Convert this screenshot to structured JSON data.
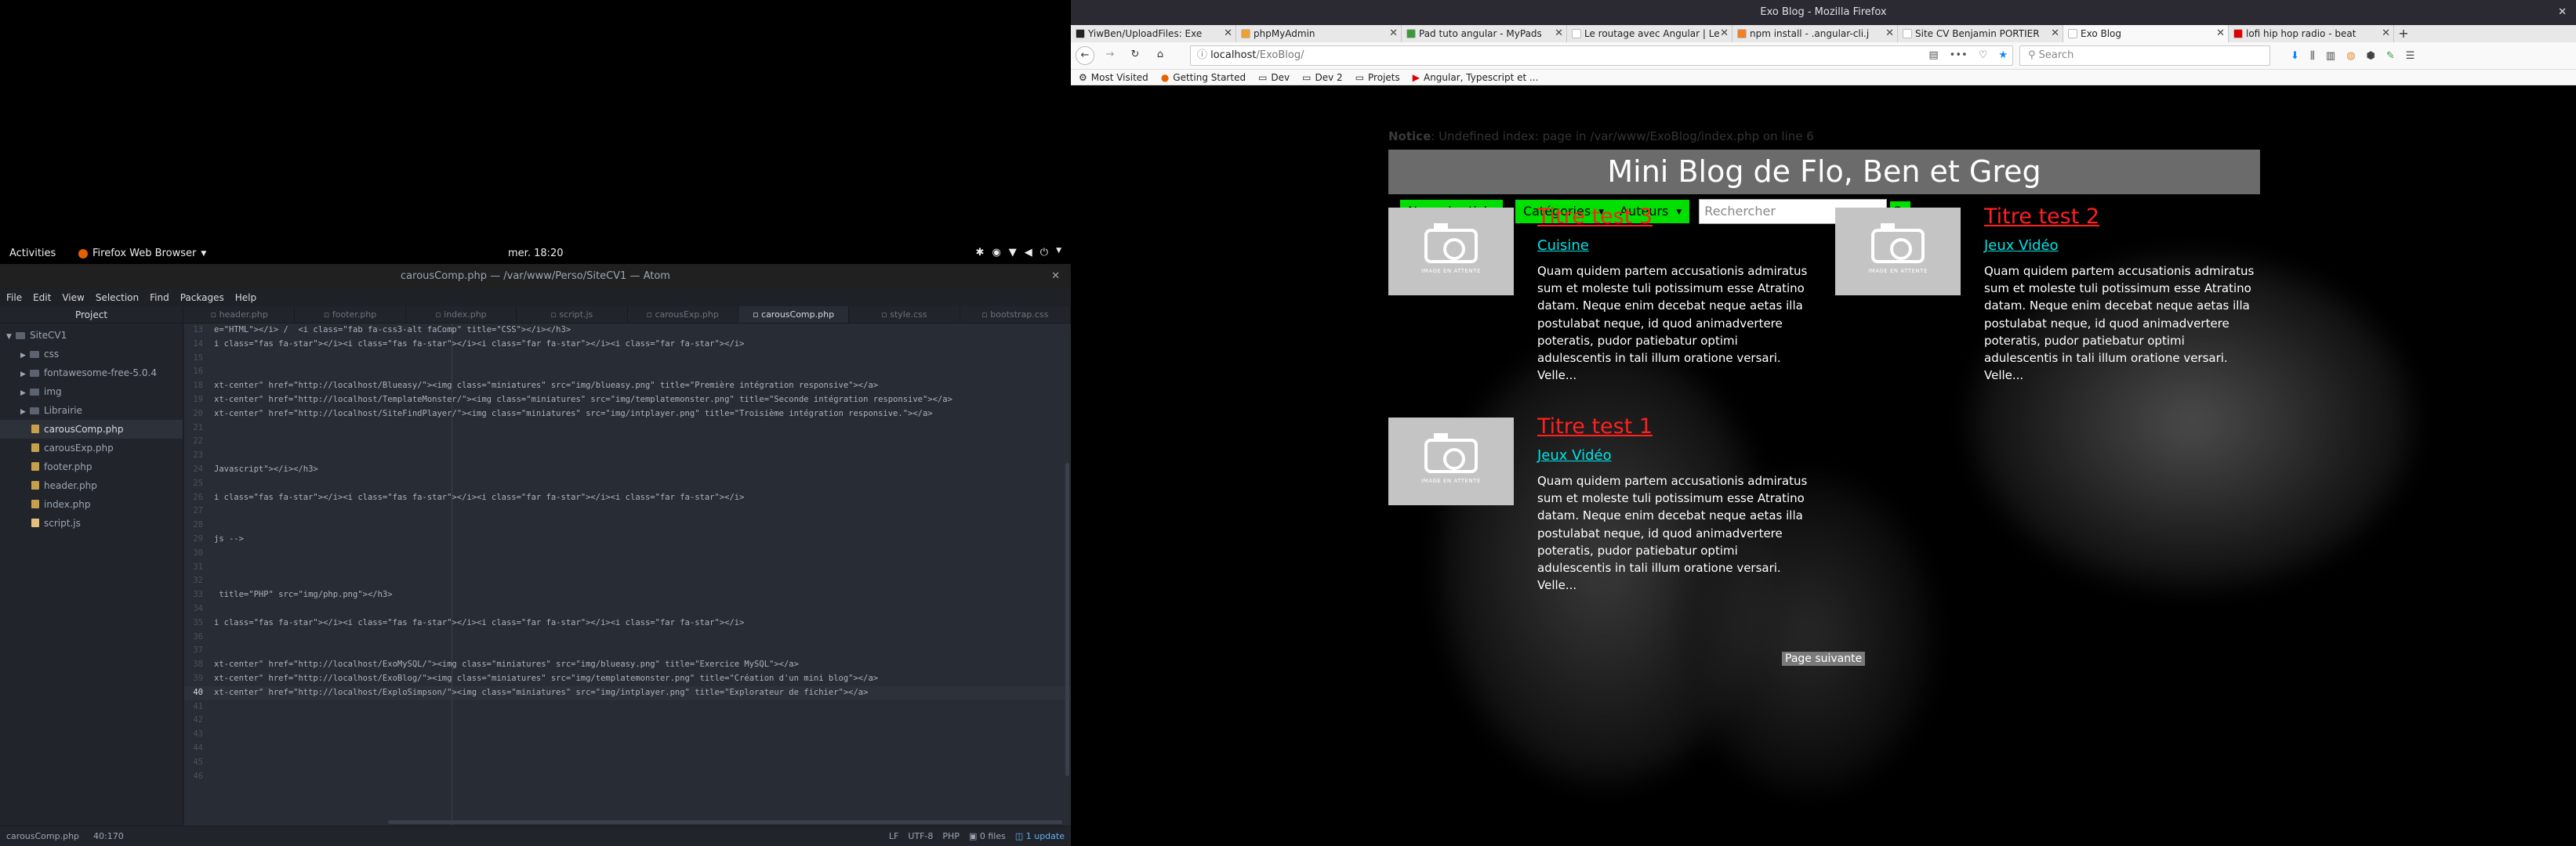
{
  "gnome": {
    "activities": "Activities",
    "app_menu": "Firefox Web Browser",
    "clock": "mer. 18:20"
  },
  "atom": {
    "title": "carousComp.php — /var/www/Perso/SiteCV1 — Atom",
    "menu": [
      "File",
      "Edit",
      "View",
      "Selection",
      "Find",
      "Packages",
      "Help"
    ],
    "tree_header": "Project",
    "tree": [
      {
        "label": "SiteCV1",
        "type": "root"
      },
      {
        "label": "css",
        "type": "folder"
      },
      {
        "label": "fontawesome-free-5.0.4",
        "type": "folder"
      },
      {
        "label": "img",
        "type": "folder"
      },
      {
        "label": "Librairie",
        "type": "folder"
      },
      {
        "label": "carousComp.php",
        "type": "file",
        "selected": true
      },
      {
        "label": "carousExp.php",
        "type": "file"
      },
      {
        "label": "footer.php",
        "type": "file"
      },
      {
        "label": "header.php",
        "type": "file"
      },
      {
        "label": "index.php",
        "type": "file"
      },
      {
        "label": "script.js",
        "type": "js"
      }
    ],
    "tabs": [
      "header.php",
      "footer.php",
      "index.php",
      "script.js",
      "carousExp.php",
      "carousComp.php",
      "style.css",
      "bootstrap.css"
    ],
    "active_tab": "carousComp.php",
    "code_lines": [
      {
        "n": "13",
        "t": "e=\"HTML\"></i> /  <i class=\"fab fa-css3-alt faComp\" title=\"CSS\"></i></h3>"
      },
      {
        "n": "14",
        "t": "i class=\"fas fa-star\"></i><i class=\"fas fa-star\"></i><i class=\"far fa-star\"></i><i class=\"far fa-star\"></i>"
      },
      {
        "n": "15",
        "t": ""
      },
      {
        "n": "16",
        "t": ""
      },
      {
        "n": "18",
        "t": "xt-center\" href=\"http://localhost/Blueasy/\"><img class=\"miniatures\" src=\"img/blueasy.png\" title=\"Première intégration responsive\"></a>"
      },
      {
        "n": "19",
        "t": "xt-center\" href=\"http://localhost/TemplateMonster/\"><img class=\"miniatures\" src=\"img/templatemonster.png\" title=\"Seconde intégration responsive\"></a>"
      },
      {
        "n": "20",
        "t": "xt-center\" href=\"http://localhost/SiteFindPlayer/\"><img class=\"miniatures\" src=\"img/intplayer.png\" title=\"Troisième intégration responsive.\"></a>"
      },
      {
        "n": "21",
        "t": ""
      },
      {
        "n": "22",
        "t": ""
      },
      {
        "n": "23",
        "t": ""
      },
      {
        "n": "24",
        "t": "Javascript\"></i></h3>"
      },
      {
        "n": "25",
        "t": ""
      },
      {
        "n": "26",
        "t": "i class=\"fas fa-star\"></i><i class=\"fas fa-star\"></i><i class=\"far fa-star\"></i><i class=\"far fa-star\"></i>"
      },
      {
        "n": "27",
        "t": ""
      },
      {
        "n": "28",
        "t": ""
      },
      {
        "n": "29",
        "t": "js -->"
      },
      {
        "n": "30",
        "t": ""
      },
      {
        "n": "31",
        "t": ""
      },
      {
        "n": "32",
        "t": ""
      },
      {
        "n": "33",
        "t": " title=\"PHP\" src=\"img/php.png\"></h3>"
      },
      {
        "n": "34",
        "t": ""
      },
      {
        "n": "35",
        "t": "i class=\"fas fa-star\"></i><i class=\"fas fa-star\"></i><i class=\"far fa-star\"></i><i class=\"far fa-star\"></i>"
      },
      {
        "n": "36",
        "t": ""
      },
      {
        "n": "37",
        "t": ""
      },
      {
        "n": "38",
        "t": "xt-center\" href=\"http://localhost/ExoMySQL/\"><img class=\"miniatures\" src=\"img/blueasy.png\" title=\"Exercice MySQL\"></a>"
      },
      {
        "n": "39",
        "t": "xt-center\" href=\"http://localhost/ExoBlog/\"><img class=\"miniatures\" src=\"img/templatemonster.png\" title=\"Création d'un mini blog\"></a>"
      },
      {
        "n": "40",
        "t": "xt-center\" href=\"http://localhost/ExploSimpson/\"><img class=\"miniatures\" src=\"img/intplayer.png\" title=\"Explorateur de fichier\"></a>",
        "current": true
      },
      {
        "n": "41",
        "t": ""
      },
      {
        "n": "42",
        "t": ""
      },
      {
        "n": "43",
        "t": ""
      },
      {
        "n": "44",
        "t": ""
      },
      {
        "n": "45",
        "t": ""
      },
      {
        "n": "46",
        "t": ""
      }
    ],
    "status": {
      "file": "carousComp.php",
      "cursor": "40:170",
      "eol": "LF",
      "encoding": "UTF-8",
      "grammar": "PHP",
      "files": "0 files",
      "update": "1 update"
    }
  },
  "firefox": {
    "window_title": "Exo Blog - Mozilla Firefox",
    "tabs": [
      {
        "label": "YiwBen/UploadFiles: Exe",
        "color": "#222222"
      },
      {
        "label": "phpMyAdmin",
        "color": "#f0a030"
      },
      {
        "label": "Pad tuto angular - MyPads",
        "color": "#3a9a3a"
      },
      {
        "label": "Le routage avec Angular | Le",
        "color": "#ffffff"
      },
      {
        "label": "npm install - .angular-cli.j",
        "color": "#f48024"
      },
      {
        "label": "Site CV Benjamin PORTIER",
        "color": "#ffffff"
      },
      {
        "label": "Exo Blog",
        "color": "#ffffff",
        "active": true
      },
      {
        "label": "lofi hip hop radio - beat",
        "color": "#e00000"
      }
    ],
    "url_host": "localhost",
    "url_path": "/ExoBlog/",
    "search_placeholder": "Search",
    "bookmarks": [
      "Most Visited",
      "Getting Started",
      "Dev",
      "Dev 2",
      "Projets",
      "Angular, Typescript et ..."
    ]
  },
  "blog": {
    "notice_label": "Notice",
    "notice_text": ": Undefined index: page in /var/www/ExoBlog/index.php on line 6",
    "title": "Mini Blog de Flo, Ben et Greg",
    "new_article": "Nouvel article",
    "categories": "Catégories",
    "authors": "Auteurs",
    "search_placeholder": "Rechercher",
    "go": "Go",
    "thumb_text": "IMAGE EN ATTENTE",
    "excerpt": "Quam quidem partem accusationis admiratus sum et moleste tuli potissimum esse Atratino datam. Neque enim decebat neque aetas illa postulabat neque, id quod animadvertere poteratis, pudor patiebatur optimi adulescentis in tali illum oratione versari. Velle...",
    "posts": [
      {
        "title": "Titre test 3",
        "category": "Cuisine"
      },
      {
        "title": "Titre test 2",
        "category": "Jeux Vidéo"
      },
      {
        "title": "Titre test 1",
        "category": "Jeux Vidéo"
      }
    ],
    "next_page": "Page suivante"
  }
}
